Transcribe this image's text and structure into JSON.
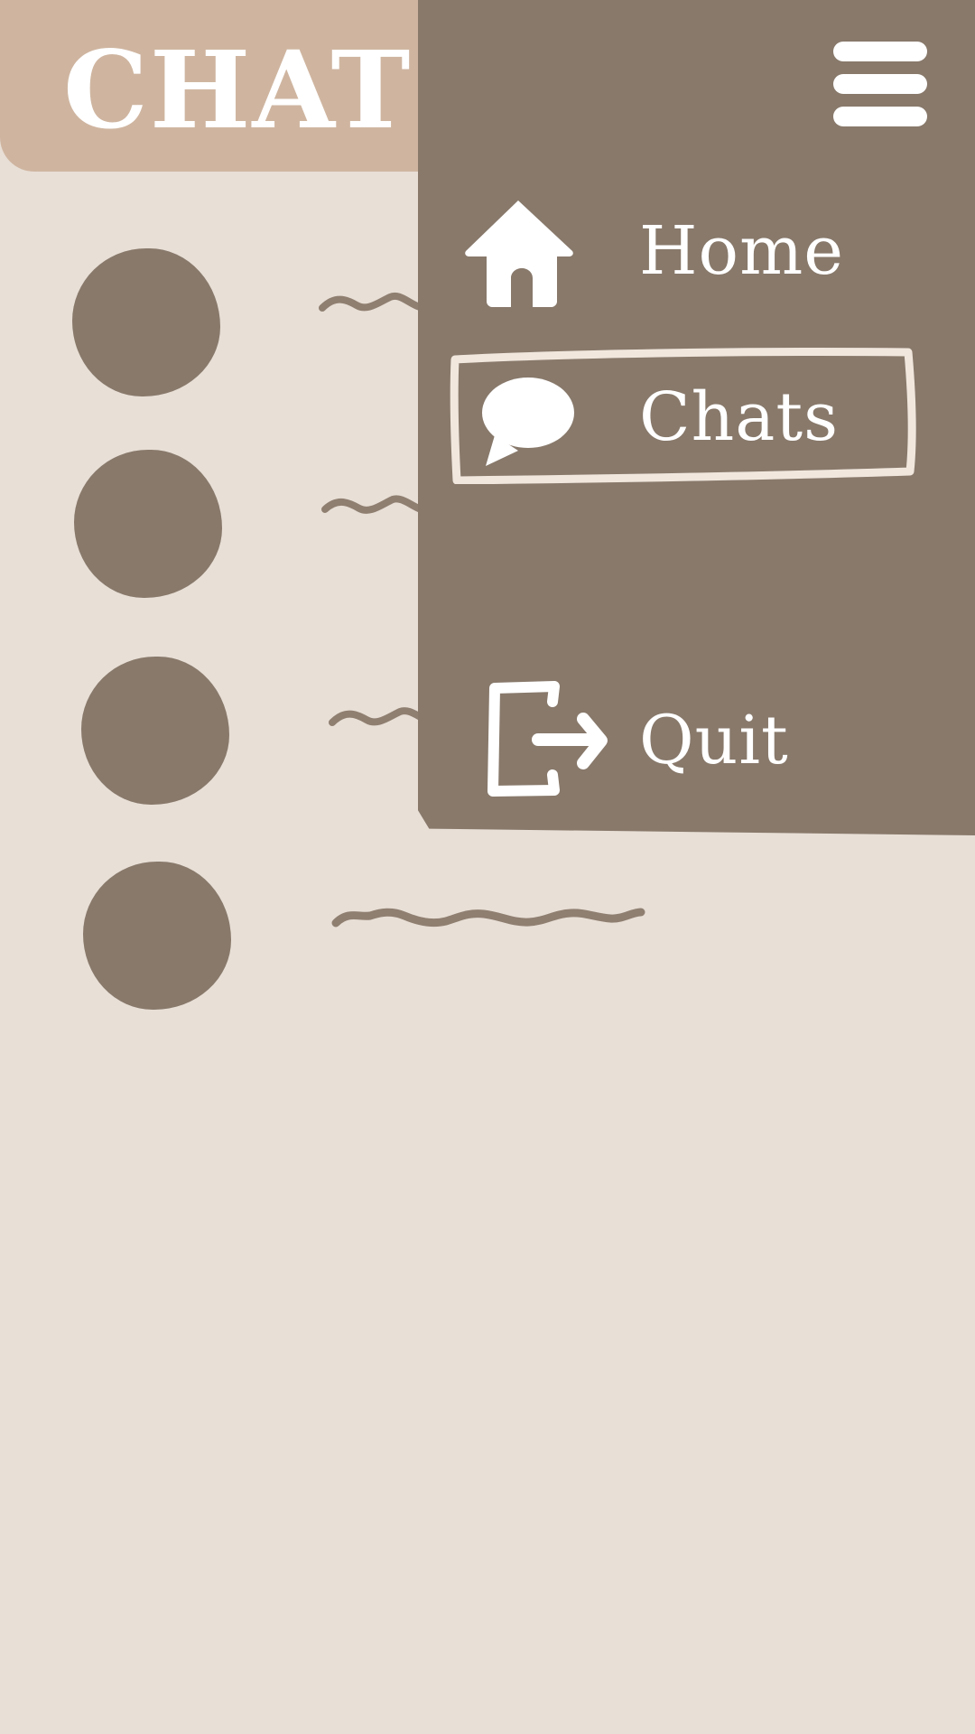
{
  "header": {
    "title": "CHATS"
  },
  "drawer": {
    "menu_icon": "hamburger-menu-icon",
    "items": [
      {
        "label": "Home",
        "icon": "home-icon",
        "active": false
      },
      {
        "label": "Chats",
        "icon": "chat-bubble-icon",
        "active": true
      },
      {
        "label": "Quit",
        "icon": "logout-icon",
        "active": false
      }
    ]
  },
  "chat_list": {
    "item_count": 4
  },
  "colors": {
    "background": "#e8dfd6",
    "header": "#cfb5a0",
    "drawer": "#88796b",
    "avatar": "#88796b",
    "text_on_dark": "#ffffff"
  }
}
